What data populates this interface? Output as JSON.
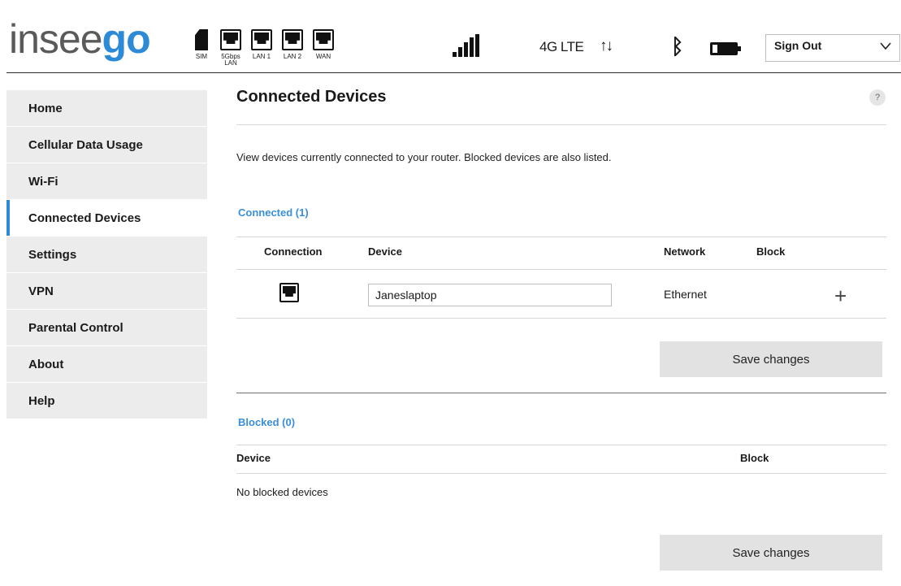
{
  "brand": {
    "logo_part1": "insee",
    "logo_part2": "go"
  },
  "header": {
    "status_icons": [
      {
        "name": "sim",
        "label": "SIM"
      },
      {
        "name": "5gbps-lan",
        "label": "5Gbps LAN"
      },
      {
        "name": "lan-1",
        "label": "LAN 1"
      },
      {
        "name": "lan-2",
        "label": "LAN 2"
      },
      {
        "name": "wan",
        "label": "WAN"
      }
    ],
    "network_type": "4G LTE",
    "sign_out": {
      "label": "Sign Out"
    }
  },
  "sidebar": {
    "active_color": "#2d8ad6",
    "items": [
      {
        "label": "Home"
      },
      {
        "label": "Cellular Data Usage"
      },
      {
        "label": "Wi-Fi"
      },
      {
        "label": "Connected Devices",
        "active": true
      },
      {
        "label": "Settings"
      },
      {
        "label": "VPN"
      },
      {
        "label": "Parental Control"
      },
      {
        "label": "About"
      },
      {
        "label": "Help"
      }
    ]
  },
  "main": {
    "title": "Connected Devices",
    "help_icon": "?",
    "description": "View devices currently connected to your router. Blocked devices are also listed.",
    "connected": {
      "title": "Connected (1)",
      "headers": {
        "connection": "Connection",
        "device": "Device",
        "network": "Network",
        "block": "Block"
      },
      "rows": [
        {
          "connection_icon": "ethernet-icon",
          "device_name": "Janeslaptop",
          "network": "Ethernet",
          "block_action": "+"
        }
      ],
      "save_label": "Save changes"
    },
    "blocked": {
      "title": "Blocked (0)",
      "headers": {
        "device": "Device",
        "block": "Block"
      },
      "empty_text": "No blocked devices",
      "save_label": "Save changes"
    }
  },
  "colors": {
    "accent": "#2d8ad6",
    "logo_gray": "#5a5a5a",
    "nav_bg": "#ececec",
    "button_bg": "#e2e2e2"
  }
}
